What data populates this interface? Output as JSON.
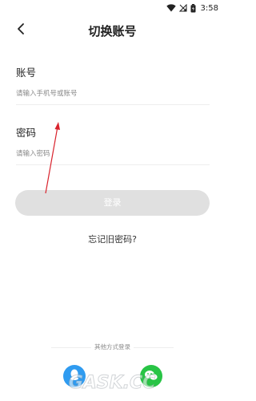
{
  "status_bar": {
    "time": "3:58",
    "icons": [
      "wifi-icon",
      "signal-off-icon",
      "battery-icon"
    ]
  },
  "header": {
    "title": "切换账号",
    "back_icon": "chevron-left-icon"
  },
  "account": {
    "label": "账号",
    "placeholder": "请输入手机号或账号",
    "value": ""
  },
  "password": {
    "label": "密码",
    "placeholder": "请输入密码",
    "value": ""
  },
  "login_button": {
    "label": "登录"
  },
  "forgot_password": {
    "label": "忘记旧密码?"
  },
  "other_login": {
    "label": "其他方式登录",
    "methods": [
      "qq-icon",
      "wechat-icon"
    ]
  },
  "watermark": {
    "text": "GASK.CC"
  },
  "colors": {
    "button_disabled": "#e0e0e0",
    "annotation_red": "#d9232d",
    "qq_blue": "#2f9bf0",
    "wechat_green": "#28c445",
    "divider": "#eeeeee",
    "placeholder": "#8a8a8a"
  }
}
